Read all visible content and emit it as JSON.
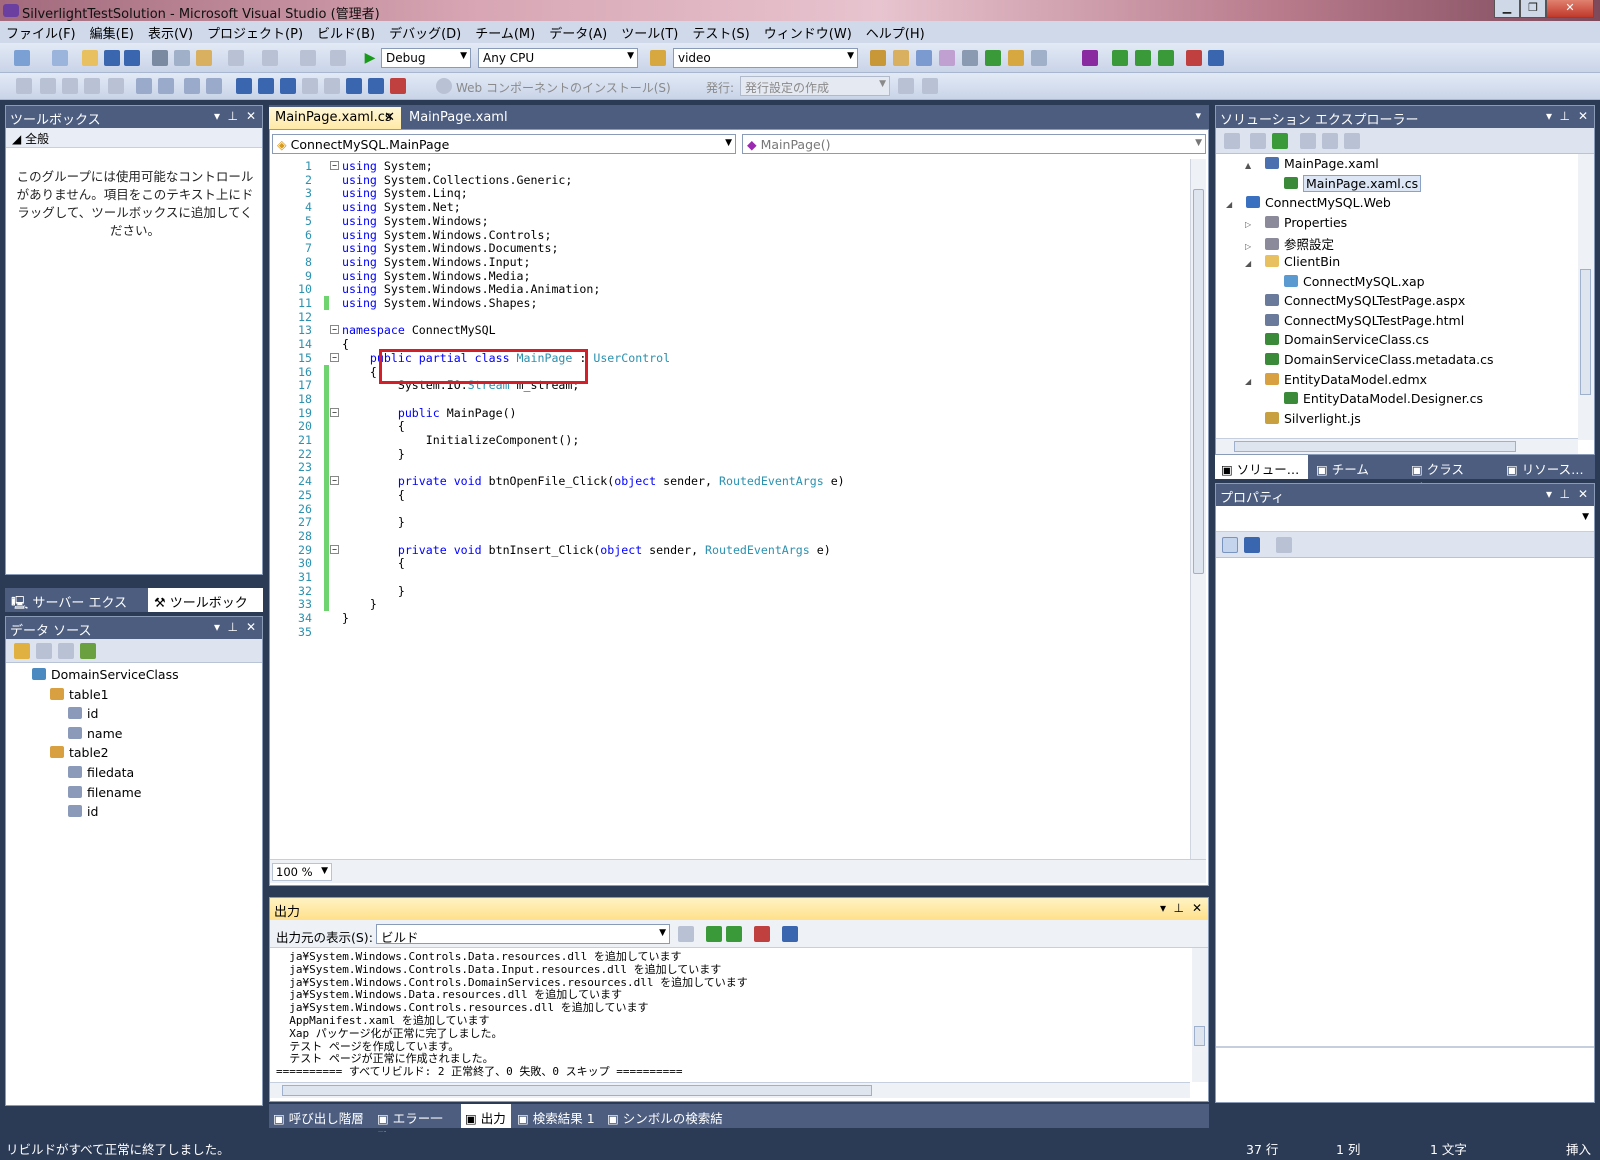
{
  "window": {
    "title": "SilverlightTestSolution - Microsoft Visual Studio (管理者)"
  },
  "menu": [
    "ファイル(F)",
    "編集(E)",
    "表示(V)",
    "プロジェクト(P)",
    "ビルド(B)",
    "デバッグ(D)",
    "チーム(M)",
    "データ(A)",
    "ツール(T)",
    "テスト(S)",
    "ウィンドウ(W)",
    "ヘルプ(H)"
  ],
  "toolbar": {
    "config": "Debug",
    "platform": "Any CPU",
    "find": "video",
    "web_install": "Web コンポーネントのインストール(S)",
    "publish_label": "発行:",
    "publish_combo": "発行設定の作成"
  },
  "toolbox": {
    "title": "ツールボックス",
    "group": "全般",
    "empty_message": "このグループには使用可能なコントロールがありません。項目をこのテキスト上にドラッグして、ツールボックスに追加してください。",
    "tabs": [
      "サーバー エクスプ…",
      "ツールボックス"
    ]
  },
  "data_sources": {
    "title": "データ ソース",
    "tree": [
      {
        "label": "DomainServiceClass",
        "level": 0,
        "icon": "domain-service-icon"
      },
      {
        "label": "table1",
        "level": 1,
        "icon": "table-icon"
      },
      {
        "label": "id",
        "level": 2,
        "icon": "numeric-field-icon"
      },
      {
        "label": "name",
        "level": 2,
        "icon": "text-field-icon"
      },
      {
        "label": "table2",
        "level": 1,
        "icon": "table-icon"
      },
      {
        "label": "filedata",
        "level": 2,
        "icon": "binary-field-icon"
      },
      {
        "label": "filename",
        "level": 2,
        "icon": "text-field-icon"
      },
      {
        "label": "id",
        "level": 2,
        "icon": "numeric-field-icon"
      }
    ]
  },
  "editor": {
    "tabs": [
      "MainPage.xaml.cs",
      "MainPage.xaml"
    ],
    "type_combo": "ConnectMySQL.MainPage",
    "member_combo": "MainPage()",
    "zoom": "100 %",
    "lines": [
      "using System;",
      "using System.Collections.Generic;",
      "using System.Linq;",
      "using System.Net;",
      "using System.Windows;",
      "using System.Windows.Controls;",
      "using System.Windows.Documents;",
      "using System.Windows.Input;",
      "using System.Windows.Media;",
      "using System.Windows.Media.Animation;",
      "using System.Windows.Shapes;",
      "",
      "namespace ConnectMySQL",
      "{",
      "    public partial class MainPage : UserControl",
      "    {",
      "        System.IO.Stream m_stream;",
      "",
      "        public MainPage()",
      "        {",
      "            InitializeComponent();",
      "        }",
      "",
      "        private void btnOpenFile_Click(object sender, RoutedEventArgs e)",
      "        {",
      "",
      "        }",
      "",
      "        private void btnInsert_Click(object sender, RoutedEventArgs e)",
      "        {",
      "",
      "        }",
      "    }",
      "}",
      ""
    ]
  },
  "output": {
    "title": "出力",
    "source_label": "出力元の表示(S):",
    "source_value": "ビルド",
    "lines": [
      "  ja¥System.Windows.Controls.Data.resources.dll を追加しています",
      "  ja¥System.Windows.Controls.Data.Input.resources.dll を追加しています",
      "  ja¥System.Windows.Controls.DomainServices.resources.dll を追加しています",
      "  ja¥System.Windows.Data.resources.dll を追加しています",
      "  ja¥System.Windows.Controls.resources.dll を追加しています",
      "  AppManifest.xaml を追加しています",
      "  Xap パッケージ化が正常に完了しました。",
      "  テスト ページを作成しています。",
      "  テスト ページが正常に作成されました。",
      "========== すべてリビルド: 2 正常終了、0 失敗、0 スキップ =========="
    ],
    "bottom_tabs": [
      "呼び出し階層",
      "エラー一覧",
      "出力",
      "検索結果 1",
      "シンボルの検索結果"
    ]
  },
  "solution_explorer": {
    "title": "ソリューション エクスプローラー",
    "tree": [
      {
        "label": "MainPage.xaml",
        "level": 1,
        "arrow": "▲",
        "icon": "xaml-file-icon"
      },
      {
        "label": "MainPage.xaml.cs",
        "level": 2,
        "arrow": "",
        "icon": "cs-file-icon",
        "selected": true
      },
      {
        "label": "ConnectMySQL.Web",
        "level": 0,
        "arrow": "◢",
        "icon": "web-project-icon"
      },
      {
        "label": "Properties",
        "level": 1,
        "arrow": "▷",
        "icon": "properties-icon"
      },
      {
        "label": "参照設定",
        "level": 1,
        "arrow": "▷",
        "icon": "references-icon"
      },
      {
        "label": "ClientBin",
        "level": 1,
        "arrow": "◢",
        "icon": "folder-icon"
      },
      {
        "label": "ConnectMySQL.xap",
        "level": 2,
        "arrow": "",
        "icon": "xap-file-icon"
      },
      {
        "label": "ConnectMySQLTestPage.aspx",
        "level": 1,
        "arrow": "",
        "icon": "aspx-file-icon"
      },
      {
        "label": "ConnectMySQLTestPage.html",
        "level": 1,
        "arrow": "",
        "icon": "html-file-icon"
      },
      {
        "label": "DomainServiceClass.cs",
        "level": 1,
        "arrow": "",
        "icon": "cs-file-icon"
      },
      {
        "label": "DomainServiceClass.metadata.cs",
        "level": 1,
        "arrow": "",
        "icon": "cs-file-icon"
      },
      {
        "label": "EntityDataModel.edmx",
        "level": 1,
        "arrow": "◢",
        "icon": "edmx-file-icon"
      },
      {
        "label": "EntityDataModel.Designer.cs",
        "level": 2,
        "arrow": "",
        "icon": "cs-file-icon"
      },
      {
        "label": "Silverlight.js",
        "level": 1,
        "arrow": "",
        "icon": "js-file-icon"
      }
    ],
    "tabs": [
      "ソリュー…",
      "チーム エ…",
      "クラス ビ…",
      "リソース…"
    ]
  },
  "properties": {
    "title": "プロパティ"
  },
  "statusbar": {
    "message": "リビルドがすべて正常に終了しました。",
    "line": "37 行",
    "col": "1 列",
    "ch": "1 文字",
    "mode": "挿入"
  },
  "colors": {
    "accent": "#4c5d80",
    "keyword": "#0000ff",
    "type": "#2b91af",
    "highlight": "#d31f2a"
  }
}
